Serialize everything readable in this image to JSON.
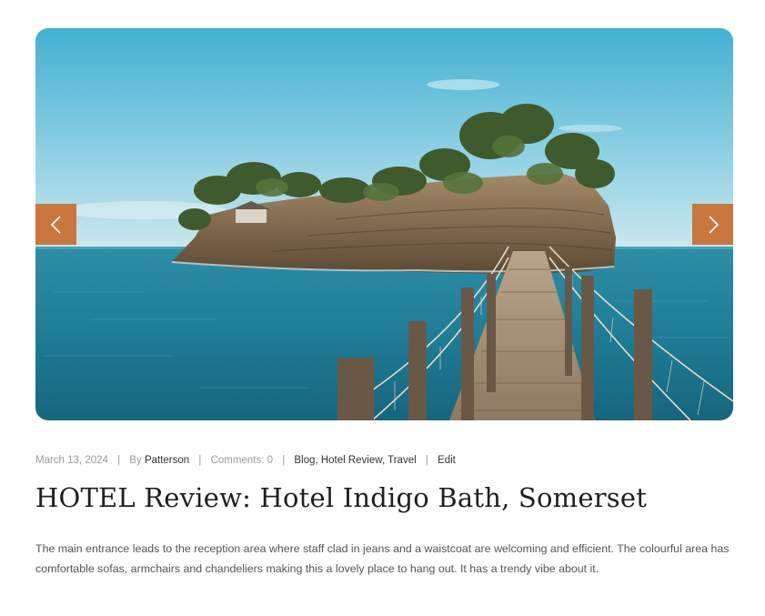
{
  "post": {
    "image": {
      "alt": "Wooden rope bridge leading to a small rocky island with trees in turquoise sea"
    },
    "slider": {
      "prev_icon": "chevron-left-icon",
      "next_icon": "chevron-right-icon",
      "accent": "#c8773f"
    },
    "meta": {
      "date": "March 13, 2024",
      "by_prefix": "By ",
      "author": "Patterson",
      "comments": "Comments: 0",
      "category_1": "Blog",
      "category_2": "Hotel Review",
      "category_3": "Travel",
      "category_sep": ", ",
      "edit": "Edit",
      "divider": "|"
    },
    "title": "HOTEL Review: Hotel Indigo Bath, Somerset",
    "excerpt": "The main entrance leads to the reception area where staff clad in jeans and a waistcoat are welcoming and efficient. The colourful area has comfortable sofas, armchairs and chandeliers making this a lovely place to hang out. It has a trendy vibe about it."
  }
}
